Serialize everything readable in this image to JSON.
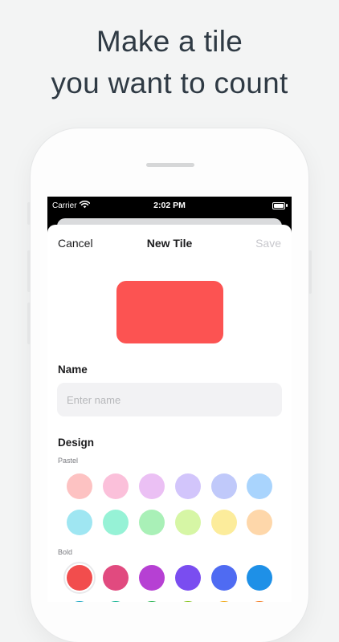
{
  "headline": {
    "line1": "Make a tile",
    "line2": "you want to count"
  },
  "status_bar": {
    "carrier": "Carrier",
    "time": "2:02 PM"
  },
  "nav": {
    "cancel": "Cancel",
    "title": "New Tile",
    "save": "Save"
  },
  "preview": {
    "color": "#fc5352"
  },
  "name": {
    "label": "Name",
    "placeholder": "Enter name",
    "value": ""
  },
  "design": {
    "label": "Design",
    "groups": [
      {
        "label": "Pastel",
        "rows": [
          [
            "#fdc2c2",
            "#fbc0da",
            "#ebc0f4",
            "#d2c5fb",
            "#c0c9fa",
            "#a9d4fd"
          ],
          [
            "#9fe6f2",
            "#96f2d6",
            "#a9f0b7",
            "#d6f6a5",
            "#fcec9b",
            "#fed7aa"
          ]
        ]
      },
      {
        "label": "Bold",
        "rows": [
          [
            "#f24d4d",
            "#e14a7f",
            "#b640d3",
            "#7a4df0",
            "#4f6bf2",
            "#1e90e7"
          ],
          [
            "#17a5c2",
            "#14b392",
            "#2ab453",
            "#84c21b",
            "#f0a712",
            "#f47a1f"
          ]
        ]
      }
    ],
    "selected": "#f24d4d"
  }
}
